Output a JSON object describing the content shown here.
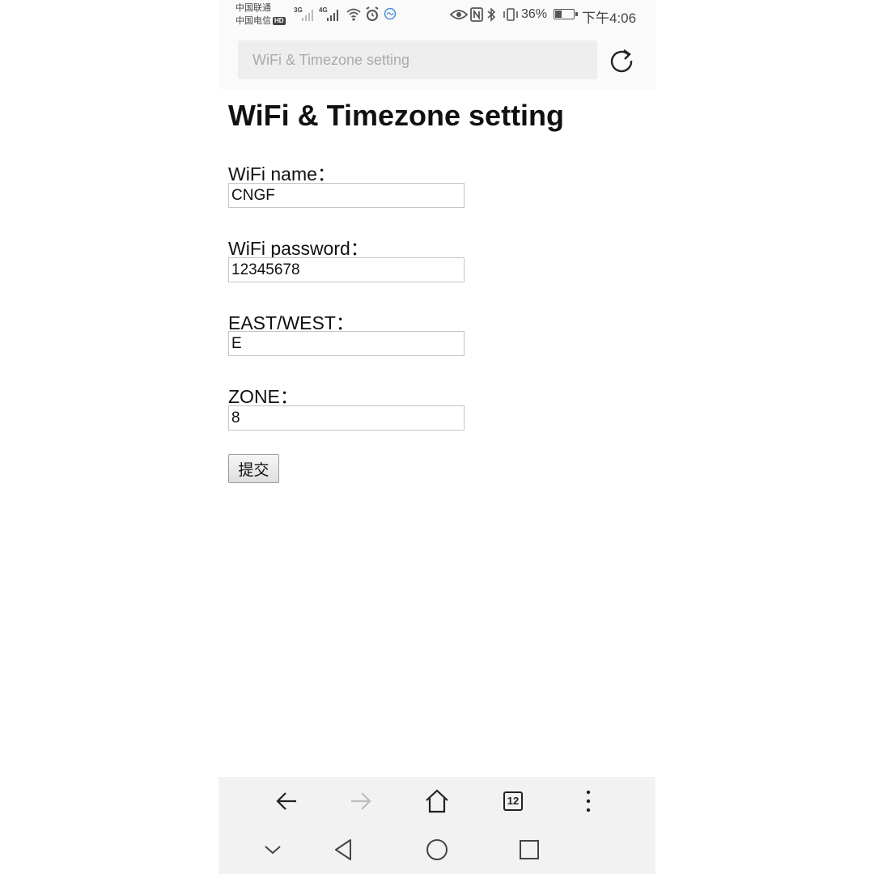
{
  "status_bar": {
    "carrier_1": "中国联通",
    "carrier_2": "中国电信",
    "hd_badge": "HD",
    "net_1": "3G",
    "net_2": "4G",
    "battery_percent": "36%",
    "battery_level": 0.36,
    "time": "下午4:06"
  },
  "browser": {
    "url_text": "WiFi & Timezone setting",
    "tab_count": "12"
  },
  "page": {
    "title": "WiFi & Timezone setting",
    "fields": [
      {
        "label": "WiFi name：",
        "value": "CNGF"
      },
      {
        "label": "WiFi password：",
        "value": "12345678"
      },
      {
        "label": "EAST/WEST：",
        "value": "E"
      },
      {
        "label": "ZONE：",
        "value": "8"
      }
    ],
    "submit_label": "提交"
  },
  "colors": {
    "bar_background": "#f2f2f2",
    "disabled_icon": "#bdbdbd"
  }
}
